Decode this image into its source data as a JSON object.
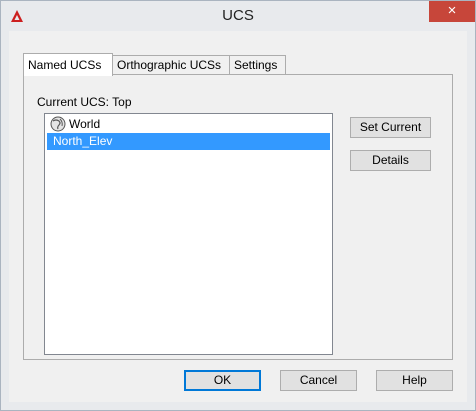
{
  "window": {
    "title": "UCS",
    "close_glyph": "×",
    "logo_icon": "autocad-logo-icon"
  },
  "tabs": [
    {
      "label": "Named UCSs",
      "active": true
    },
    {
      "label": "Orthographic UCSs",
      "active": false
    },
    {
      "label": "Settings",
      "active": false
    }
  ],
  "current_ucs": {
    "label": "Current UCS:",
    "value": "Top"
  },
  "ucs_list": {
    "items": [
      {
        "label": "World",
        "icon": "globe-icon",
        "selected": false
      },
      {
        "label": "North_Elev",
        "icon": "",
        "selected": true
      }
    ]
  },
  "side_buttons": {
    "set_current": "Set Current",
    "details": "Details"
  },
  "footer_buttons": {
    "ok": "OK",
    "cancel": "Cancel",
    "help": "Help"
  },
  "colors": {
    "selection": "#3399ff",
    "close": "#c7463a",
    "logo": "#cc1f1f"
  }
}
